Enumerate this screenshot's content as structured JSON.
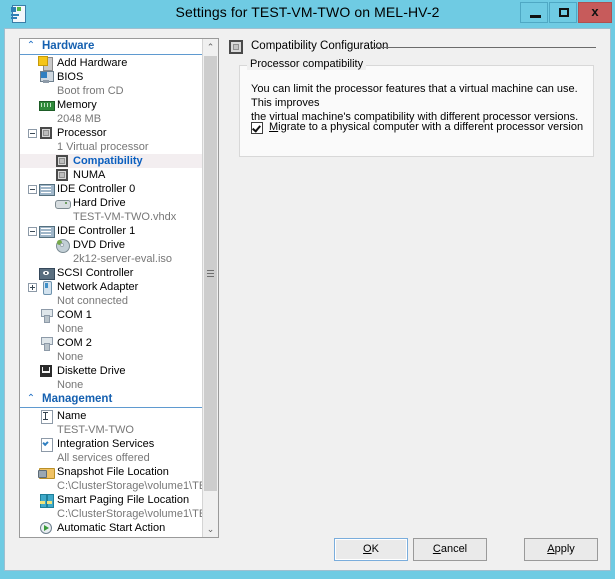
{
  "window": {
    "title": "Settings for TEST-VM-TWO on MEL-HV-2",
    "icon": "settings-document-icon",
    "controls": {
      "minimize": "—",
      "maximize": "□",
      "close": "x"
    }
  },
  "tree": {
    "scroll_up": "⌃",
    "scroll_down": "⌄",
    "groups": [
      {
        "name": "hardware",
        "label": "Hardware",
        "chevron": "⌃",
        "items": [
          {
            "icon": "add-hardware-icon",
            "label": "Add Hardware",
            "sub": null,
            "indent": 18,
            "expander": null,
            "selected": false
          },
          {
            "icon": "bios-icon",
            "label": "BIOS",
            "sub": "Boot from CD",
            "indent": 18,
            "expander": null,
            "selected": false
          },
          {
            "icon": "memory-icon",
            "label": "Memory",
            "sub": "2048 MB",
            "indent": 18,
            "expander": null,
            "selected": false
          },
          {
            "icon": "processor-icon",
            "label": "Processor",
            "sub": "1 Virtual processor",
            "indent": 18,
            "expander": "minus",
            "selected": false
          },
          {
            "icon": "compatibility-icon",
            "label": "Compatibility",
            "sub": null,
            "indent": 34,
            "expander": null,
            "selected": true
          },
          {
            "icon": "numa-icon",
            "label": "NUMA",
            "sub": null,
            "indent": 34,
            "expander": null,
            "selected": false
          },
          {
            "icon": "ide-controller-icon",
            "label": "IDE Controller 0",
            "sub": null,
            "indent": 18,
            "expander": "minus",
            "selected": false
          },
          {
            "icon": "hard-drive-icon",
            "label": "Hard Drive",
            "sub": "TEST-VM-TWO.vhdx",
            "indent": 34,
            "expander": null,
            "selected": false
          },
          {
            "icon": "ide-controller-icon",
            "label": "IDE Controller 1",
            "sub": null,
            "indent": 18,
            "expander": "minus",
            "selected": false
          },
          {
            "icon": "dvd-drive-icon",
            "label": "DVD Drive",
            "sub": "2k12-server-eval.iso",
            "indent": 34,
            "expander": null,
            "selected": false
          },
          {
            "icon": "scsi-controller-icon",
            "label": "SCSI Controller",
            "sub": null,
            "indent": 18,
            "expander": null,
            "selected": false
          },
          {
            "icon": "network-adapter-icon",
            "label": "Network Adapter",
            "sub": "Not connected",
            "indent": 18,
            "expander": "plus",
            "selected": false
          },
          {
            "icon": "com-port-icon",
            "label": "COM 1",
            "sub": "None",
            "indent": 18,
            "expander": null,
            "selected": false
          },
          {
            "icon": "com-port-icon",
            "label": "COM 2",
            "sub": "None",
            "indent": 18,
            "expander": null,
            "selected": false
          },
          {
            "icon": "diskette-drive-icon",
            "label": "Diskette Drive",
            "sub": "None",
            "indent": 18,
            "expander": null,
            "selected": false
          }
        ]
      },
      {
        "name": "management",
        "label": "Management",
        "chevron": "⌃",
        "items": [
          {
            "icon": "name-icon",
            "label": "Name",
            "sub": "TEST-VM-TWO",
            "indent": 18,
            "expander": null,
            "selected": false
          },
          {
            "icon": "integration-services-icon",
            "label": "Integration Services",
            "sub": "All services offered",
            "indent": 18,
            "expander": null,
            "selected": false
          },
          {
            "icon": "snapshot-file-location-icon",
            "label": "Snapshot File Location",
            "sub": "C:\\ClusterStorage\\volume1\\TE...",
            "indent": 18,
            "expander": null,
            "selected": false
          },
          {
            "icon": "smart-paging-file-location-icon",
            "label": "Smart Paging File Location",
            "sub": "C:\\ClusterStorage\\volume1\\TE...",
            "indent": 18,
            "expander": null,
            "selected": false
          },
          {
            "icon": "automatic-start-action-icon",
            "label": "Automatic Start Action",
            "sub": null,
            "indent": 18,
            "expander": null,
            "selected": false
          }
        ]
      }
    ]
  },
  "pane": {
    "header": "Compatibility Configuration",
    "header_icon": "compatibility-icon",
    "group_title": "Processor compatibility",
    "description_line1": "You can limit the processor features that a virtual machine can use. This improves",
    "description_line2": "the virtual machine's compatibility with different processor versions.",
    "checkbox": {
      "checked": true,
      "accel": "M",
      "label_rest": "igrate to a physical computer with a different processor version"
    }
  },
  "buttons": {
    "ok": {
      "accel": "O",
      "rest": "K",
      "focused": true
    },
    "cancel": {
      "accel": "C",
      "rest": "ancel",
      "focused": false
    },
    "apply": {
      "accel": "A",
      "rest": "pply",
      "focused": false
    }
  },
  "colors": {
    "titlebar": "#6fcbe3",
    "close_button": "#c75b5b",
    "group_header_text": "#1560b0",
    "selection_text": "#0b5fbf",
    "selection_bg": "#f3eef0",
    "dialog_bg": "#f0f0f0"
  }
}
